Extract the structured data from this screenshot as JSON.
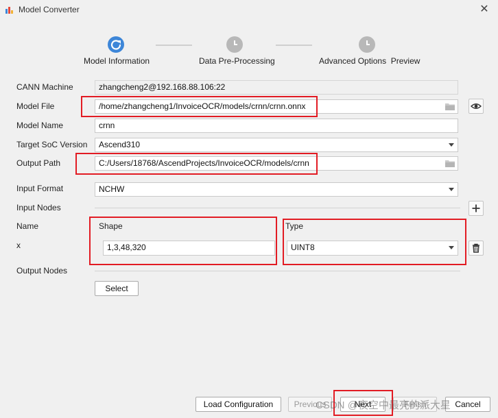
{
  "window": {
    "title": "Model Converter",
    "close_glyph": "✕"
  },
  "steps": [
    {
      "label": "Model Information",
      "state": "active"
    },
    {
      "label": "Data Pre-Processing",
      "state": "pending"
    },
    {
      "label": "Advanced Options  Preview",
      "state": "pending"
    }
  ],
  "form": {
    "cann_machine": {
      "label": "CANN Machine",
      "value": "zhangcheng2@192.168.88.106:22"
    },
    "model_file": {
      "label": "Model File",
      "value": "/home/zhangcheng1/InvoiceOCR/models/crnn/crnn.onnx"
    },
    "model_name": {
      "label": "Model Name",
      "value": "crnn"
    },
    "target_soc": {
      "label": "Target SoC Version",
      "value": "Ascend310"
    },
    "output_path": {
      "label": "Output Path",
      "value": "C:/Users/18768/AscendProjects/InvoiceOCR/models/crnn"
    },
    "input_format": {
      "label": "Input Format",
      "value": "NCHW"
    },
    "input_nodes": {
      "label": "Input Nodes"
    },
    "table": {
      "name_header": "Name",
      "shape_header": "Shape",
      "type_header": "Type",
      "row": {
        "name": "x",
        "shape": "1,3,48,320",
        "type": "UINT8"
      }
    },
    "output_nodes": {
      "label": "Output Nodes",
      "select_label": "Select"
    }
  },
  "footer": {
    "load_config": "Load Configuration",
    "previous": "Previous",
    "next": "Next",
    "finish": "Finish",
    "cancel": "Cancel"
  },
  "watermark": "CSDN @夜空中最亮的派大星",
  "colors": {
    "accent": "#3d86d8",
    "highlight": "#e21b23"
  }
}
